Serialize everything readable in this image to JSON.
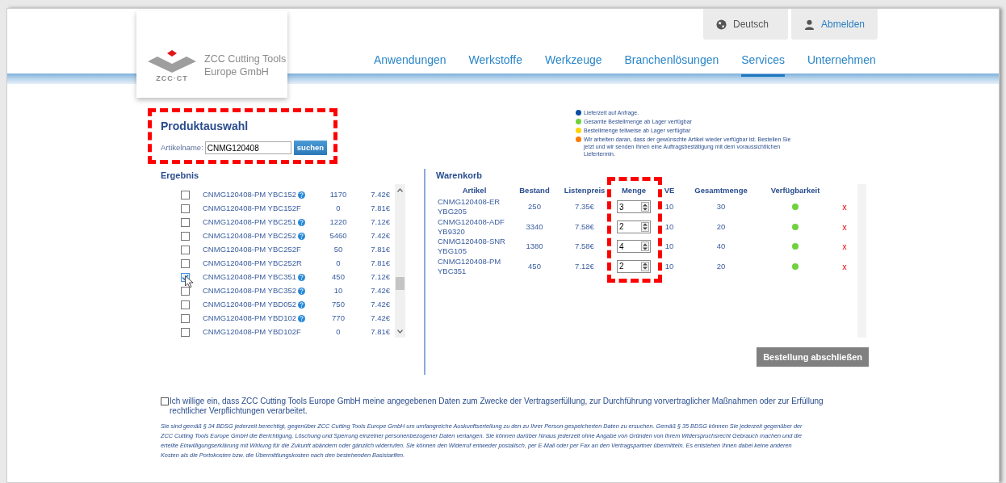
{
  "header": {
    "logo": {
      "mark": "ZCC·CT",
      "company_lines": [
        "ZCC Cutting Tools",
        "Europe GmbH"
      ]
    },
    "top_buttons": [
      {
        "kind": "language",
        "label": "Deutsch"
      },
      {
        "kind": "logout",
        "label": "Abmelden"
      }
    ],
    "nav": [
      {
        "label": "Anwendungen",
        "selected": false
      },
      {
        "label": "Werkstoffe",
        "selected": false
      },
      {
        "label": "Werkzeuge",
        "selected": false
      },
      {
        "label": "Branchenlösungen",
        "selected": false
      },
      {
        "label": "Services",
        "selected": true
      },
      {
        "label": "Unternehmen",
        "selected": false
      }
    ]
  },
  "product_search": {
    "title": "Produktauswahl",
    "label": "Artikelname:",
    "value": "CNMG120408",
    "button": "suchen"
  },
  "legend": [
    {
      "color": "#0b4ea2",
      "text": "Lieferzeit auf Anfrage."
    },
    {
      "color": "#6fd13c",
      "text": "Gesamte Bestellmenge ab Lager verfügbar"
    },
    {
      "color": "#ffd200",
      "text": "Bestellmenge teilweise ab Lager verfügbar"
    },
    {
      "color": "#ff7a00",
      "text": "Wir arbeiten daran, dass der gewünschte Artikel wieder verfügbar ist. Bestellen Sie jetzt und wir senden Ihnen eine Auftragsbestätigung mit dem voraussichtlichen Liefertermin."
    }
  ],
  "results": {
    "title": "Ergebnis",
    "rows": [
      {
        "name": "CNMG120408-PM YBC152",
        "info": true,
        "stock": "1170",
        "price": "7.42€",
        "checked": false
      },
      {
        "name": "CNMG120408-PM YBC152F",
        "info": false,
        "stock": "0",
        "price": "7.81€",
        "checked": false
      },
      {
        "name": "CNMG120408-PM YBC251",
        "info": true,
        "stock": "1220",
        "price": "7.12€",
        "checked": false
      },
      {
        "name": "CNMG120408-PM YBC252",
        "info": true,
        "stock": "5460",
        "price": "7.42€",
        "checked": false
      },
      {
        "name": "CNMG120408-PM YBC252F",
        "info": false,
        "stock": "50",
        "price": "7.81€",
        "checked": false
      },
      {
        "name": "CNMG120408-PM YBC252R",
        "info": false,
        "stock": "0",
        "price": "7.81€",
        "checked": false
      },
      {
        "name": "CNMG120408-PM YBC351",
        "info": true,
        "stock": "450",
        "price": "7.12€",
        "checked": true
      },
      {
        "name": "CNMG120408-PM YBC352",
        "info": true,
        "stock": "10",
        "price": "7.42€",
        "checked": false
      },
      {
        "name": "CNMG120408-PM YBD052",
        "info": true,
        "stock": "750",
        "price": "7.42€",
        "checked": false
      },
      {
        "name": "CNMG120408-PM YBD102",
        "info": true,
        "stock": "770",
        "price": "7.42€",
        "checked": false
      },
      {
        "name": "CNMG120408-PM YBD102F",
        "info": false,
        "stock": "0",
        "price": "7.81€",
        "checked": false
      }
    ]
  },
  "cart": {
    "title": "Warenkorb",
    "columns": [
      "Artikel",
      "Bestand",
      "Listenpreis",
      "Menge",
      "VE",
      "Gesamtmenge",
      "Verfügbarkeit"
    ],
    "rows": [
      {
        "article": "CNMG120408-ER YBG205",
        "stock": "250",
        "price": "7.35€",
        "quantity": "3",
        "ve": "10",
        "total": "30",
        "color": "#6fd13c",
        "remove": "x"
      },
      {
        "article": "CNMG120408-ADF YB9320",
        "stock": "3340",
        "price": "7.58€",
        "quantity": "2",
        "ve": "10",
        "total": "20",
        "color": "#6fd13c",
        "remove": "x"
      },
      {
        "article": "CNMG120408-SNR YBG105",
        "stock": "1380",
        "price": "7.58€",
        "quantity": "4",
        "ve": "10",
        "total": "40",
        "color": "#6fd13c",
        "remove": "x"
      },
      {
        "article": "CNMG120408-PM YBC351",
        "stock": "450",
        "price": "7.12€",
        "quantity": "2",
        "ve": "10",
        "total": "20",
        "color": "#6fd13c",
        "remove": "x"
      }
    ],
    "button": "Bestellung abschließen"
  },
  "consent": {
    "checked": false,
    "text": "Ich willige ein, dass ZCC Cutting Tools Europe GmbH meine angegebenen Daten zum Zwecke der Vertragserfüllung, zur Durchführung vorvertraglicher Maßnahmen oder zur Erfüllung rechtlicher Verpflichtungen verarbeitet."
  },
  "notice": "Sie sind gemäß § 34 BDSG jederzeit berechtigt, gegenüber ZCC Cutting Tools Europe GmbH um umfangreiche Auskunftserteilung zu den zu Ihrer Person gespeicherten Daten zu ersuchen. Gemäß § 35 BDSG können Sie jederzeit gegenüber der ZCC Cutting Tools Europe GmbH die Berichtigung, Löschung und Sperrung einzelner personenbezogener Daten verlangen. Sie können darüber hinaus jederzeit ohne Angabe von Gründen von Ihrem Widerspruchsrecht Gebrauch machen und die erteilte Einwilligungserklärung mit Wirkung für die Zukunft abändern oder gänzlich widerrufen. Sie können den Widerruf entweder postalisch, per E-Mail oder per Fax an den Vertragspartner übermitteln. Es entstehen Ihnen dabei keine anderen Kosten als die Portokosten bzw. die Übermittlungskosten nach den bestehenden Basistarifen."
}
